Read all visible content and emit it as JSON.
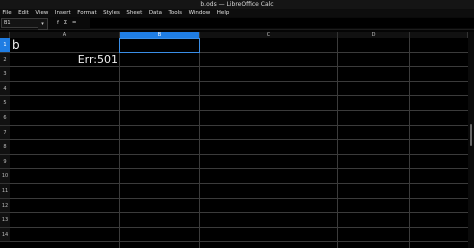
{
  "window": {
    "title": "b.ods — LibreOffice Calc"
  },
  "menubar": [
    "File",
    "Edit",
    "View",
    "Insert",
    "Format",
    "Styles",
    "Sheet",
    "Data",
    "Tools",
    "Window",
    "Help"
  ],
  "namebox": {
    "value": "B1",
    "arrow": "▾"
  },
  "formula_bar": {
    "fx_label": "f",
    "sum_label": "Σ",
    "equals_label": "="
  },
  "columns": [
    "A",
    "B",
    "C",
    "D"
  ],
  "rows": [
    "1",
    "2",
    "3",
    "4",
    "5",
    "6",
    "7",
    "8",
    "9",
    "10",
    "11",
    "12",
    "13",
    "14"
  ],
  "cells": {
    "A1": "b",
    "A2": "Err:501"
  },
  "selected_cell": "B1",
  "colors": {
    "accent": "#1f7de3",
    "background": "#000000",
    "gridline": "#3b3b3b"
  }
}
